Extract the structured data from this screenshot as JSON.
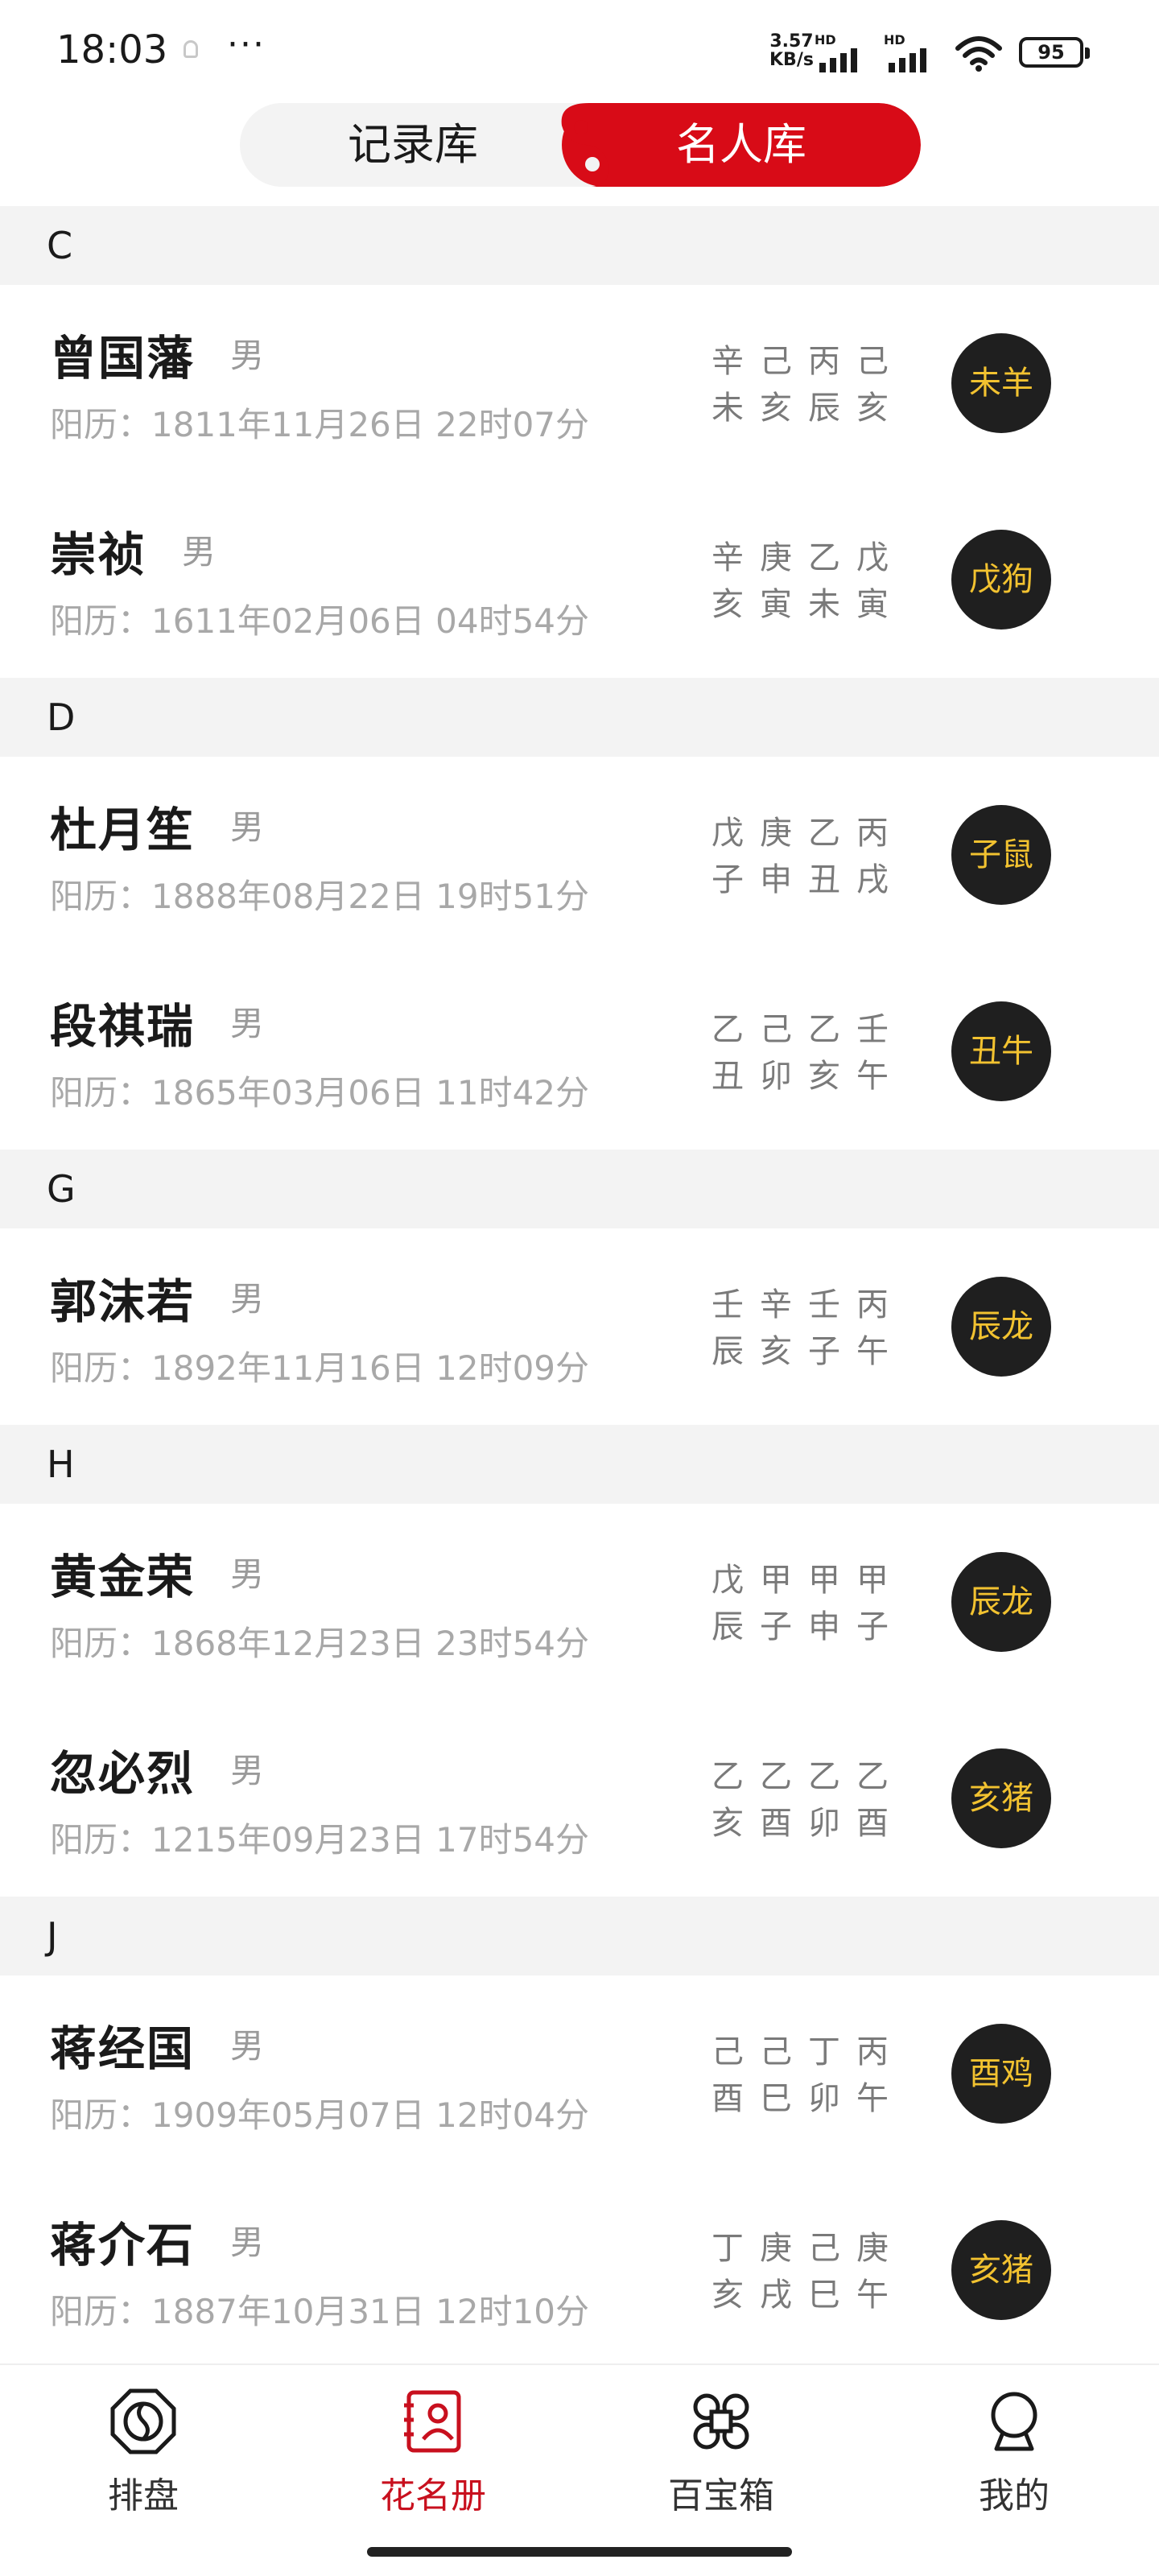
{
  "status_bar": {
    "time": "18:03",
    "more": "···",
    "net_speed_value": "3.57",
    "net_speed_unit": "KB/s",
    "hd1": "HD",
    "hd2": "HD",
    "battery": "95"
  },
  "tabs": {
    "left_label": "记录库",
    "right_label": "名人库",
    "active": "名人库"
  },
  "sections": [
    {
      "letter": "C",
      "people": [
        {
          "name": "曾国藩",
          "gender": "男",
          "date": "阳历：1811年11月26日 22时07分",
          "stems": "辛己丙己",
          "branches": "未亥辰亥",
          "zodiac": "未羊"
        },
        {
          "name": "崇祯",
          "gender": "男",
          "date": "阳历：1611年02月06日 04时54分",
          "stems": "辛庚乙戊",
          "branches": "亥寅未寅",
          "zodiac": "戊狗"
        }
      ]
    },
    {
      "letter": "D",
      "people": [
        {
          "name": "杜月笙",
          "gender": "男",
          "date": "阳历：1888年08月22日 19时51分",
          "stems": "戊庚乙丙",
          "branches": "子申丑戌",
          "zodiac": "子鼠"
        },
        {
          "name": "段祺瑞",
          "gender": "男",
          "date": "阳历：1865年03月06日 11时42分",
          "stems": "乙己乙壬",
          "branches": "丑卯亥午",
          "zodiac": "丑牛"
        }
      ]
    },
    {
      "letter": "G",
      "people": [
        {
          "name": "郭沫若",
          "gender": "男",
          "date": "阳历：1892年11月16日 12时09分",
          "stems": "壬辛壬丙",
          "branches": "辰亥子午",
          "zodiac": "辰龙"
        }
      ]
    },
    {
      "letter": "H",
      "people": [
        {
          "name": "黄金荣",
          "gender": "男",
          "date": "阳历：1868年12月23日 23时54分",
          "stems": "戊甲甲甲",
          "branches": "辰子申子",
          "zodiac": "辰龙"
        },
        {
          "name": "忽必烈",
          "gender": "男",
          "date": "阳历：1215年09月23日 17时54分",
          "stems": "乙乙乙乙",
          "branches": "亥酉卯酉",
          "zodiac": "亥猪"
        }
      ]
    },
    {
      "letter": "J",
      "people": [
        {
          "name": "蒋经国",
          "gender": "男",
          "date": "阳历：1909年05月07日 12时04分",
          "stems": "己己丁丙",
          "branches": "酉巳卯午",
          "zodiac": "酉鸡"
        },
        {
          "name": "蒋介石",
          "gender": "男",
          "date": "阳历：1887年10月31日 12时10分",
          "stems": "丁庚己庚",
          "branches": "亥戌巳午",
          "zodiac": "亥猪"
        }
      ]
    }
  ],
  "bottom_nav": [
    {
      "label": "排盘",
      "icon": "bagua-icon"
    },
    {
      "label": "花名册",
      "icon": "roster-icon",
      "active": true
    },
    {
      "label": "百宝箱",
      "icon": "command-icon"
    },
    {
      "label": "我的",
      "icon": "profile-icon"
    }
  ],
  "colors": {
    "accent": "#d80b17",
    "zodiac_bg": "#1f1f1f",
    "zodiac_text": "#f2c230",
    "section_bg": "#f3f3f3"
  }
}
